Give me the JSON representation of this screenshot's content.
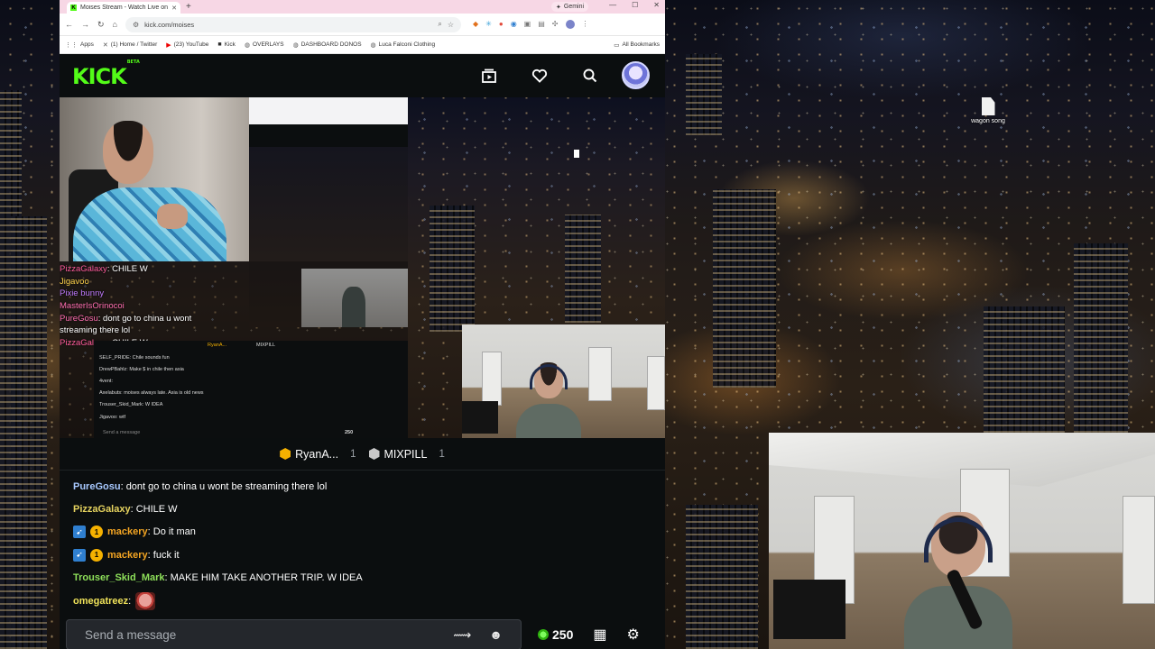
{
  "browser": {
    "tab_title": "Moises Stream - Watch Live on",
    "tab_favicon": "K",
    "gemini_label": "Gemini",
    "url": "kick.com/moises",
    "bookmarks": [
      {
        "icon": "apps-icon",
        "label": "Apps"
      },
      {
        "icon": "x-icon",
        "label": "(1) Home / Twitter"
      },
      {
        "icon": "youtube-icon",
        "label": "(23) YouTube"
      },
      {
        "icon": "kick-icon",
        "label": "Kick"
      },
      {
        "icon": "globe-icon",
        "label": "OVERLAYS"
      },
      {
        "icon": "globe-icon",
        "label": "DASHBOARD DONOS"
      },
      {
        "icon": "globe-icon",
        "label": "Luca Falconi Clothing"
      }
    ],
    "all_bookmarks": "All Bookmarks"
  },
  "kick": {
    "logo": "KICK",
    "logo_tag": "BETA"
  },
  "stream_overlay": {
    "lines": [
      {
        "user": "PizzaGalaxy",
        "text": ": CHILE W"
      },
      {
        "user": "Jigavoo",
        "text": ""
      },
      {
        "user": "Pixie bunny",
        "text": ""
      },
      {
        "user": "MasterIsOrinocoi",
        "text": ""
      },
      {
        "user": "PureGosu",
        "text": ": dont go to china u wont"
      },
      {
        "user": "",
        "text": "streaming there lol"
      },
      {
        "user": "PizzaGalaxy",
        "text": ": CHILE W"
      }
    ],
    "mini_gifters": [
      "RyanA...",
      "MIXPILL"
    ],
    "mini_messages": [
      "SELF_PRIDE: Chile sounds fun",
      "DrewPBahlz: Make $ in chile then asia",
      "4vent:",
      "Axelabuts: moises always late. Asia is old news",
      "Trouser_Skid_Mark: W IDEA",
      "Jigavoo: wtf"
    ],
    "mini_input": "Send a message",
    "mini_points": "250"
  },
  "desktop": {
    "icon_label": "wagon song"
  },
  "chat": {
    "gifters": [
      {
        "name": "RyanA...",
        "count": "1",
        "color": "#f5b100"
      },
      {
        "name": "MIXPILL",
        "count": "1",
        "color": "#c8c8c8"
      }
    ],
    "messages": [
      {
        "badges": [],
        "user": "PureGosu",
        "user_color": "#a8c9ff",
        "text": ": dont go to china u wont be streaming there lol"
      },
      {
        "badges": [],
        "user": "PizzaGalaxy",
        "user_color": "#e6d35f",
        "text": ": CHILE W"
      },
      {
        "badges": [
          "boost",
          "sub"
        ],
        "sub_count": "1",
        "user": "mackery",
        "user_color": "#f5a623",
        "text": ": Do it man"
      },
      {
        "badges": [
          "boost",
          "sub"
        ],
        "sub_count": "1",
        "user": "mackery",
        "user_color": "#f5a623",
        "text": ": fuck it"
      },
      {
        "badges": [],
        "user": "Trouser_Skid_Mark",
        "user_color": "#8ee05a",
        "text": ": MAKE HIM TAKE ANOTHER TRIP. W IDEA"
      },
      {
        "badges": [],
        "user": "omegatreez",
        "user_color": "#f0e35a",
        "text": ":",
        "emote": true
      }
    ],
    "input_placeholder": "Send a message",
    "points": "250",
    "accent": "#53fc18"
  }
}
